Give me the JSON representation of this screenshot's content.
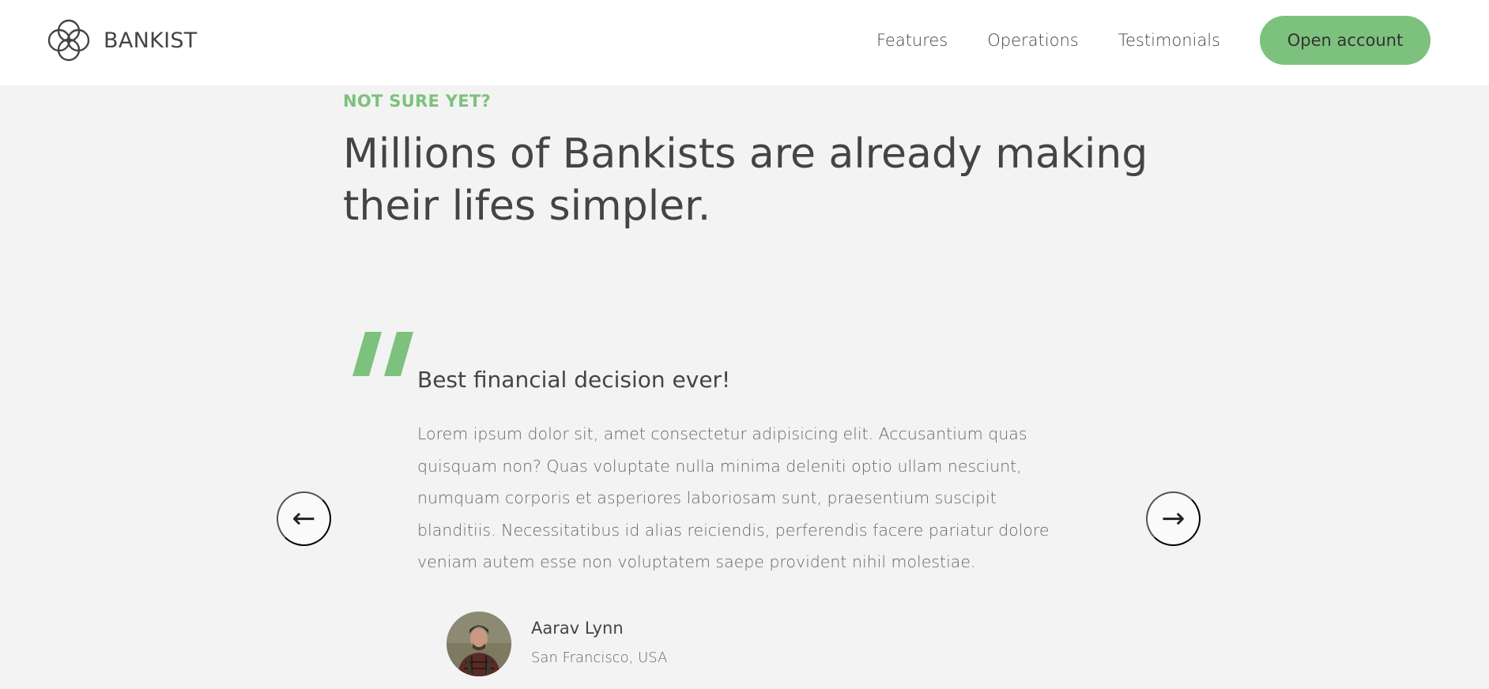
{
  "nav": {
    "brand": "BANKIST",
    "brand_icon": "logo-icon",
    "links": [
      "Features",
      "Operations",
      "Testimonials"
    ],
    "cta_label": "Open account"
  },
  "section": {
    "eyebrow": "NOT SURE YET?",
    "heading": "Millions of Bankists are already making their lifes simpler."
  },
  "testimonial": {
    "quote_icon": "quote-icon",
    "title": "Best financial decision ever!",
    "text": "Lorem ipsum dolor sit, amet consectetur adipisicing elit. Accusantium quas quisquam non? Quas voluptate nulla minima deleniti optio ullam nesciunt, numquam corporis et asperiores laboriosam sunt, praesentium suscipit blanditiis. Necessitatibus id alias reiciendis, perferendis facere pariatur dolore veniam autem esse non voluptatem saepe provident nihil molestiae.",
    "author_name": "Aarav Lynn",
    "author_location": "San Francisco, USA"
  },
  "slider": {
    "prev_symbol": "←",
    "next_symbol": "→"
  },
  "colors": {
    "accent": "#7dc17e",
    "background": "#f3f3f3",
    "nav_bg": "#ffffff",
    "text": "#444444"
  }
}
